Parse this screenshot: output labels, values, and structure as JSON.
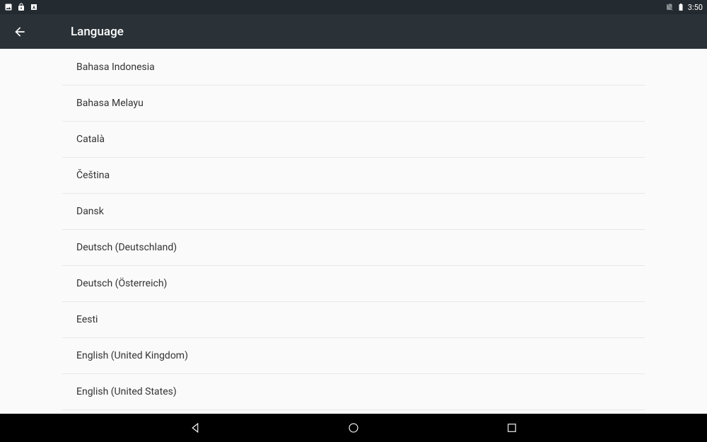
{
  "statusBar": {
    "time": "3:50"
  },
  "appBar": {
    "title": "Language"
  },
  "languages": [
    {
      "label": "Bahasa Indonesia"
    },
    {
      "label": "Bahasa Melayu"
    },
    {
      "label": "Català"
    },
    {
      "label": "Čeština"
    },
    {
      "label": "Dansk"
    },
    {
      "label": "Deutsch (Deutschland)"
    },
    {
      "label": "Deutsch (Österreich)"
    },
    {
      "label": "Eesti"
    },
    {
      "label": "English (United Kingdom)"
    },
    {
      "label": "English (United States)"
    }
  ]
}
